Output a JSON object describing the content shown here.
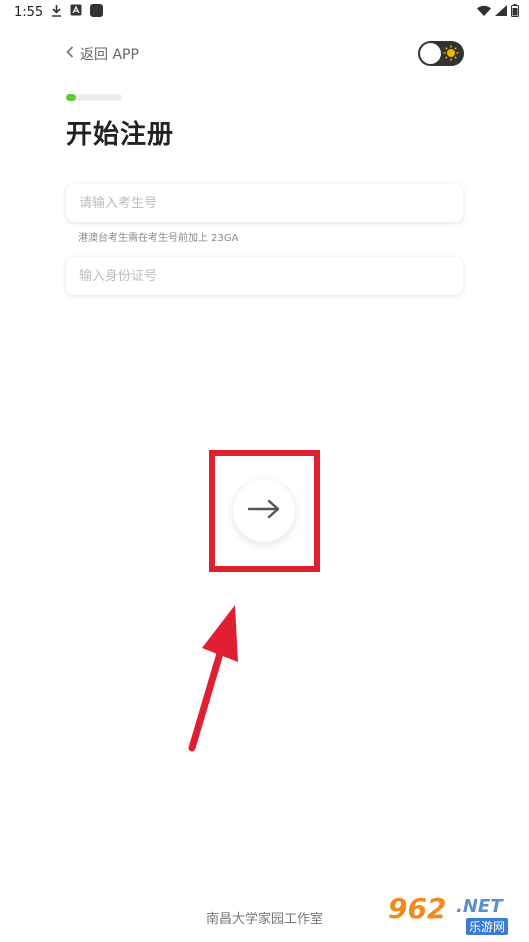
{
  "status_bar": {
    "time": "1:55"
  },
  "header": {
    "back_label": "返回 APP"
  },
  "progress": {
    "value": 0.18,
    "color": "#64c832"
  },
  "title": "开始注册",
  "form": {
    "exam_id": {
      "placeholder": "请输入考生号",
      "value": ""
    },
    "hint": "港澳台考生需在考生号前加上 23GA",
    "id_card": {
      "placeholder": "输入身份证号",
      "value": ""
    }
  },
  "footer": {
    "text": "南昌大学家园工作室"
  },
  "watermark": {
    "num": "962",
    "net": ".NET",
    "sub": "乐游网"
  },
  "colors": {
    "annotation": "#e02030",
    "toggle_bg": "#333333"
  }
}
